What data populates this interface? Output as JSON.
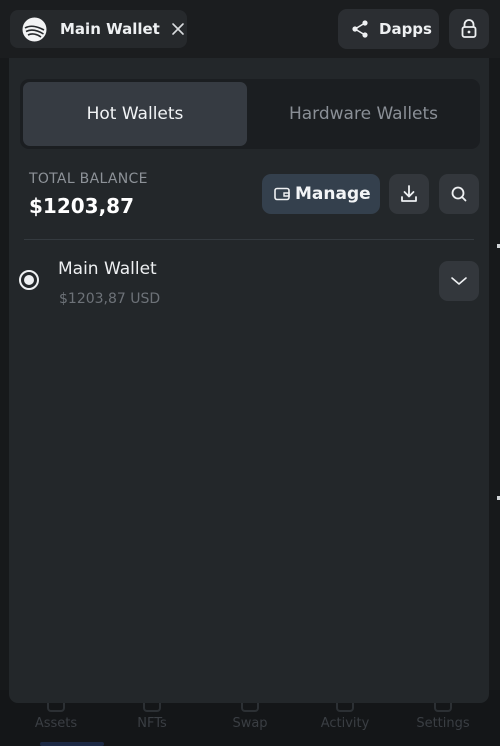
{
  "header": {
    "wallet_chip_label": "Main Wallet",
    "dapps_label": "Dapps"
  },
  "tabs": [
    {
      "label": "Hot Wallets",
      "active": true
    },
    {
      "label": "Hardware Wallets",
      "active": false
    }
  ],
  "balance": {
    "label": "TOTAL BALANCE",
    "value": "$1203,87"
  },
  "actions": {
    "manage_label": "Manage"
  },
  "wallets": [
    {
      "name": "Main Wallet",
      "balance": "$1203,87 USD",
      "selected": true
    }
  ],
  "bottom_nav": [
    {
      "label": "Assets"
    },
    {
      "label": "NFTs"
    },
    {
      "label": "Swap"
    },
    {
      "label": "Activity"
    },
    {
      "label": "Settings"
    }
  ],
  "colors": {
    "background": "#17191b",
    "panel": "#23272a",
    "active_tab": "#363b42",
    "manage_button": "#34404d",
    "text_primary": "#eef0f2",
    "text_muted": "#8d9298"
  },
  "icons": {
    "wallet_logo": "app-logo-icon",
    "close": "close-icon",
    "dapps": "share-icon",
    "lock": "lock-icon",
    "manage": "wallet-icon",
    "download": "download-icon",
    "search": "search-icon",
    "expand": "chevron-down-icon"
  }
}
